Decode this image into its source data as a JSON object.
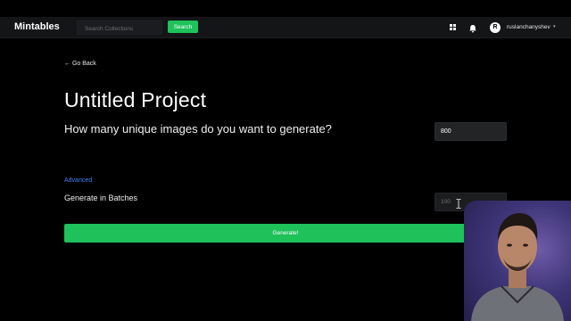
{
  "navbar": {
    "brand": "Mintables",
    "search_placeholder": "Search Collections",
    "search_button": "Search",
    "avatar_initial": "R",
    "username": "ruslanchanyshev",
    "caret": "▾"
  },
  "main": {
    "back_link": "← Go Back",
    "title": "Untitled Project",
    "question": "How many unique images do you want to generate?",
    "count_value": "800",
    "advanced_label": "Advanced",
    "batches_label": "Generate in Batches",
    "batch_placeholder": "100",
    "generate_button": "Generate!"
  },
  "colors": {
    "accent_green": "#1ec15a",
    "link_blue": "#3b82f6",
    "navbar_bg": "#141517",
    "page_bg": "#000000"
  },
  "icons": [
    "grid-icon",
    "bell-icon",
    "text-cursor-icon"
  ]
}
